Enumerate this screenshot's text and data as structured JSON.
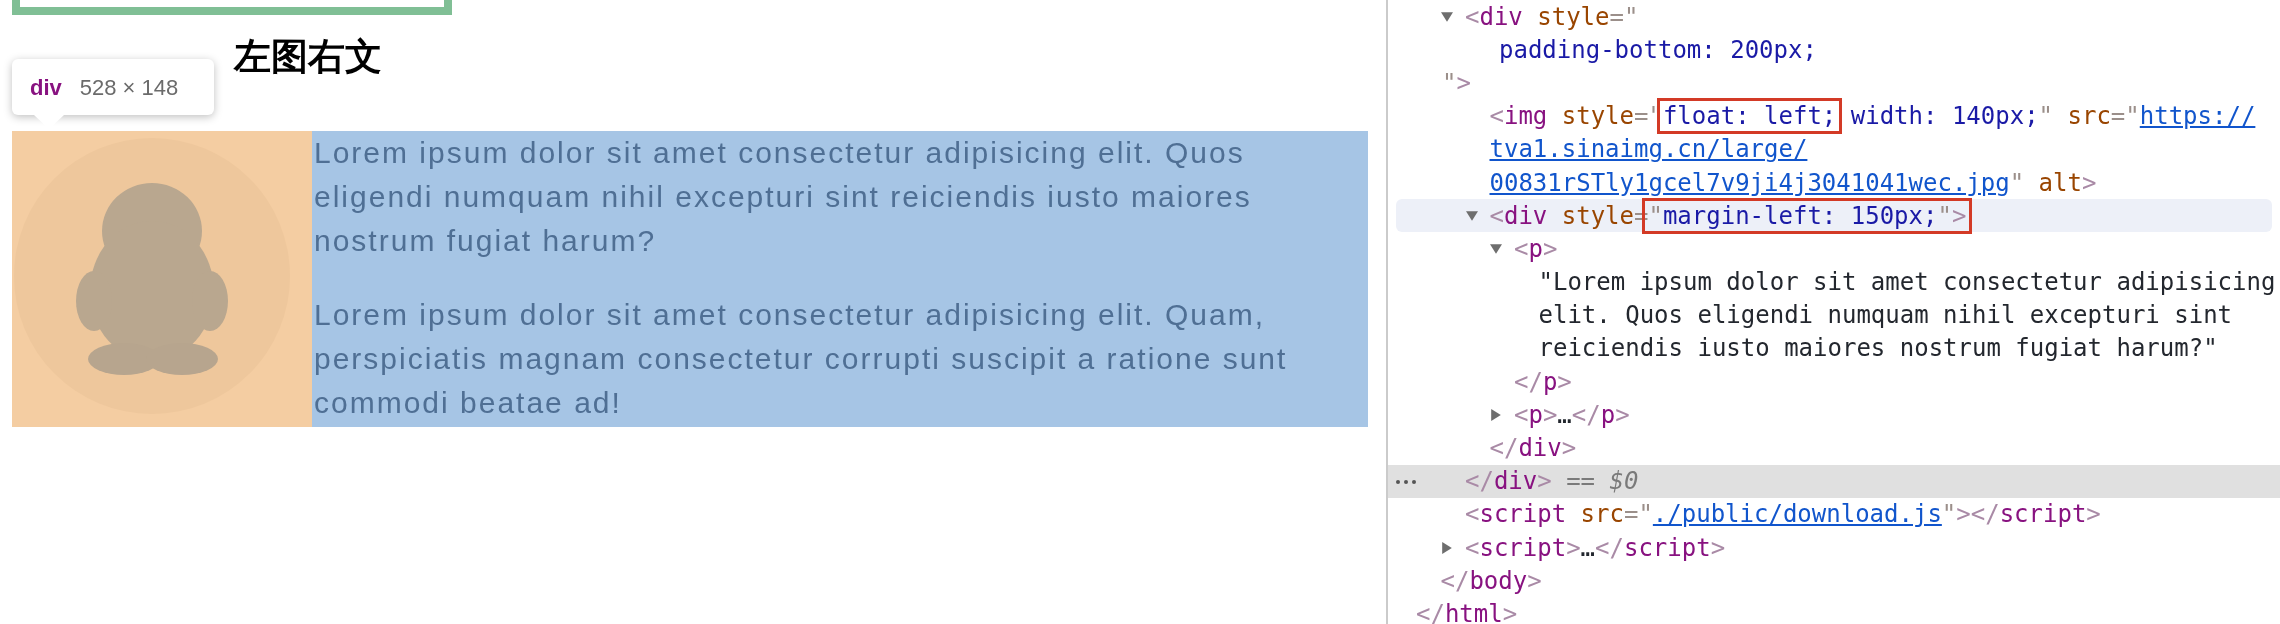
{
  "page": {
    "heading": "左图右文",
    "tooltip": {
      "tag": "div",
      "size": "528 × 148"
    },
    "image": {
      "kind": "picture"
    },
    "paragraphs": [
      "Lorem ipsum dolor sit amet consectetur adipisicing elit. Quos eligendi numquam nihil excepturi sint reiciendis iusto maiores nostrum fugiat harum?",
      "Lorem ipsum dolor sit amet consectetur adipisicing elit. Quam, perspiciatis magnam consectetur corrupti suscipit a ratione sunt commodi beatae ad!"
    ]
  },
  "devtools": {
    "tree": [
      {
        "children": [
          {
            "children": [
              {
                "expanded": true,
                "selected": true,
                "hovered": false,
                "lines": [
                  {
                    "kind": "tag",
                    "segments": [
                      {
                        "kind": "bracket",
                        "text": "<"
                      },
                      {
                        "kind": "tag",
                        "text": "div"
                      },
                      {
                        "kind": "attr",
                        "text": " style"
                      },
                      {
                        "kind": "punct",
                        "text": "=\""
                      }
                    ]
                  },
                  {
                    "kind": "attr_value",
                    "segments": [
                      {
                        "kind": "value",
                        "text": "padding-bottom: 200px;"
                      }
                    ]
                  },
                  {
                    "kind": "tail",
                    "segments": [
                      {
                        "kind": "punct",
                        "text": "\""
                      },
                      {
                        "kind": "bracket",
                        "text": ">"
                      }
                    ]
                  }
                ],
                "children": [
                  {
                    "selected": false,
                    "hovered": false,
                    "lines": [
                      {
                        "kind": "tag",
                        "segments": [
                          {
                            "kind": "bracket",
                            "text": "<"
                          },
                          {
                            "kind": "tag",
                            "text": "img"
                          },
                          {
                            "kind": "attr",
                            "text": " style"
                          },
                          {
                            "kind": "punct",
                            "text": "=\""
                          },
                          {
                            "kind": "value",
                            "text": "float: left;",
                            "boxed": true
                          },
                          {
                            "kind": "value",
                            "text": " width: 140px;"
                          },
                          {
                            "kind": "punct",
                            "text": "\""
                          },
                          {
                            "kind": "attr",
                            "text": " src"
                          },
                          {
                            "kind": "punct",
                            "text": "=\""
                          },
                          {
                            "kind": "link",
                            "text": "https://"
                          }
                        ]
                      },
                      {
                        "kind": "tag",
                        "segments": [
                          {
                            "kind": "link",
                            "text": "tva1.sinaimg.cn/large/"
                          }
                        ]
                      },
                      {
                        "kind": "tag",
                        "segments": [
                          {
                            "kind": "link",
                            "text": "00831rSTly1gcel7v9ji4j3041041wec.jpg"
                          },
                          {
                            "kind": "punct",
                            "text": "\""
                          },
                          {
                            "kind": "attr",
                            "text": " alt"
                          },
                          {
                            "kind": "bracket",
                            "text": ">"
                          }
                        ]
                      }
                    ]
                  },
                  {
                    "expanded": true,
                    "selected": false,
                    "hovered": true,
                    "lines": [
                      {
                        "kind": "tag",
                        "segments": [
                          {
                            "kind": "bracket",
                            "text": "<"
                          },
                          {
                            "kind": "tag",
                            "text": "div"
                          },
                          {
                            "kind": "attr",
                            "text": " style"
                          },
                          {
                            "kind": "punct",
                            "text": "="
                          },
                          {
                            "kind": "punct",
                            "text": "\"",
                            "boxed": true
                          },
                          {
                            "kind": "value",
                            "text": "margin-left: 150px;",
                            "boxed": true
                          },
                          {
                            "kind": "punct",
                            "text": "\"",
                            "boxed": true
                          },
                          {
                            "kind": "bracket",
                            "text": ">",
                            "boxed": true
                          }
                        ]
                      }
                    ],
                    "children": [
                      {
                        "expanded": true,
                        "selected": false,
                        "hovered": false,
                        "lines": [
                          {
                            "kind": "tag",
                            "segments": [
                              {
                                "kind": "bracket",
                                "text": "<"
                              },
                              {
                                "kind": "tag",
                                "text": "p"
                              },
                              {
                                "kind": "bracket",
                                "text": ">"
                              }
                            ]
                          }
                        ],
                        "children": [
                          {
                            "lines": [
                              {
                                "kind": "tag",
                                "segments": [
                                  {
                                    "kind": "text",
                                    "text": "\"Lorem ipsum dolor sit amet consectetur adipisicing"
                                  }
                                ]
                              },
                              {
                                "kind": "tag",
                                "segments": [
                                  {
                                    "kind": "text",
                                    "text": "elit. Quos eligendi numquam nihil excepturi sint"
                                  }
                                ]
                              },
                              {
                                "kind": "tag",
                                "segments": [
                                  {
                                    "kind": "text",
                                    "text": "reiciendis iusto maiores nostrum fugiat harum?\""
                                  }
                                ]
                              }
                            ]
                          }
                        ],
                        "closing": [
                          {
                            "kind": "bracket",
                            "text": "</"
                          },
                          {
                            "kind": "tag",
                            "text": "p"
                          },
                          {
                            "kind": "bracket",
                            "text": ">"
                          }
                        ]
                      },
                      {
                        "expanded": false,
                        "selected": false,
                        "hovered": false,
                        "lines": [
                          {
                            "kind": "tag",
                            "segments": [
                              {
                                "kind": "bracket",
                                "text": "<"
                              },
                              {
                                "kind": "tag",
                                "text": "p"
                              },
                              {
                                "kind": "bracket",
                                "text": ">"
                              },
                              {
                                "kind": "text",
                                "text": "…"
                              },
                              {
                                "kind": "bracket",
                                "text": "</"
                              },
                              {
                                "kind": "tag",
                                "text": "p"
                              },
                              {
                                "kind": "bracket",
                                "text": ">"
                              }
                            ]
                          }
                        ]
                      }
                    ],
                    "closing": [
                      {
                        "kind": "bracket",
                        "text": "</"
                      },
                      {
                        "kind": "tag",
                        "text": "div"
                      },
                      {
                        "kind": "bracket",
                        "text": ">"
                      }
                    ]
                  }
                ],
                "closing": [
                  {
                    "kind": "bracket",
                    "text": "</"
                  },
                  {
                    "kind": "tag",
                    "text": "div"
                  },
                  {
                    "kind": "bracket",
                    "text": ">"
                  },
                  {
                    "kind": "ref",
                    "text": " == $0"
                  }
                ]
              },
              {
                "selected": false,
                "hovered": false,
                "lines": [
                  {
                    "kind": "tag",
                    "segments": [
                      {
                        "kind": "bracket",
                        "text": "<"
                      },
                      {
                        "kind": "tag",
                        "text": "script"
                      },
                      {
                        "kind": "attr",
                        "text": " src"
                      },
                      {
                        "kind": "punct",
                        "text": "=\""
                      },
                      {
                        "kind": "link",
                        "text": "./public/download.js"
                      },
                      {
                        "kind": "punct",
                        "text": "\""
                      },
                      {
                        "kind": "bracket",
                        "text": ">"
                      },
                      {
                        "kind": "bracket",
                        "text": "</"
                      },
                      {
                        "kind": "tag",
                        "text": "script"
                      },
                      {
                        "kind": "bracket",
                        "text": ">"
                      }
                    ]
                  }
                ]
              },
              {
                "expanded": false,
                "selected": false,
                "hovered": false,
                "lines": [
                  {
                    "kind": "tag",
                    "segments": [
                      {
                        "kind": "bracket",
                        "text": "<"
                      },
                      {
                        "kind": "tag",
                        "text": "script"
                      },
                      {
                        "kind": "bracket",
                        "text": ">"
                      },
                      {
                        "kind": "text",
                        "text": "…"
                      },
                      {
                        "kind": "bracket",
                        "text": "</"
                      },
                      {
                        "kind": "tag",
                        "text": "script"
                      },
                      {
                        "kind": "bracket",
                        "text": ">"
                      }
                    ]
                  }
                ]
              }
            ],
            "closing": [
              {
                "kind": "bracket",
                "text": "</"
              },
              {
                "kind": "tag",
                "text": "body"
              },
              {
                "kind": "bracket",
                "text": ">"
              }
            ]
          }
        ],
        "closing": [
          {
            "kind": "bracket",
            "text": "</"
          },
          {
            "kind": "tag",
            "text": "html"
          },
          {
            "kind": "bracket",
            "text": ">"
          }
        ]
      }
    ]
  }
}
